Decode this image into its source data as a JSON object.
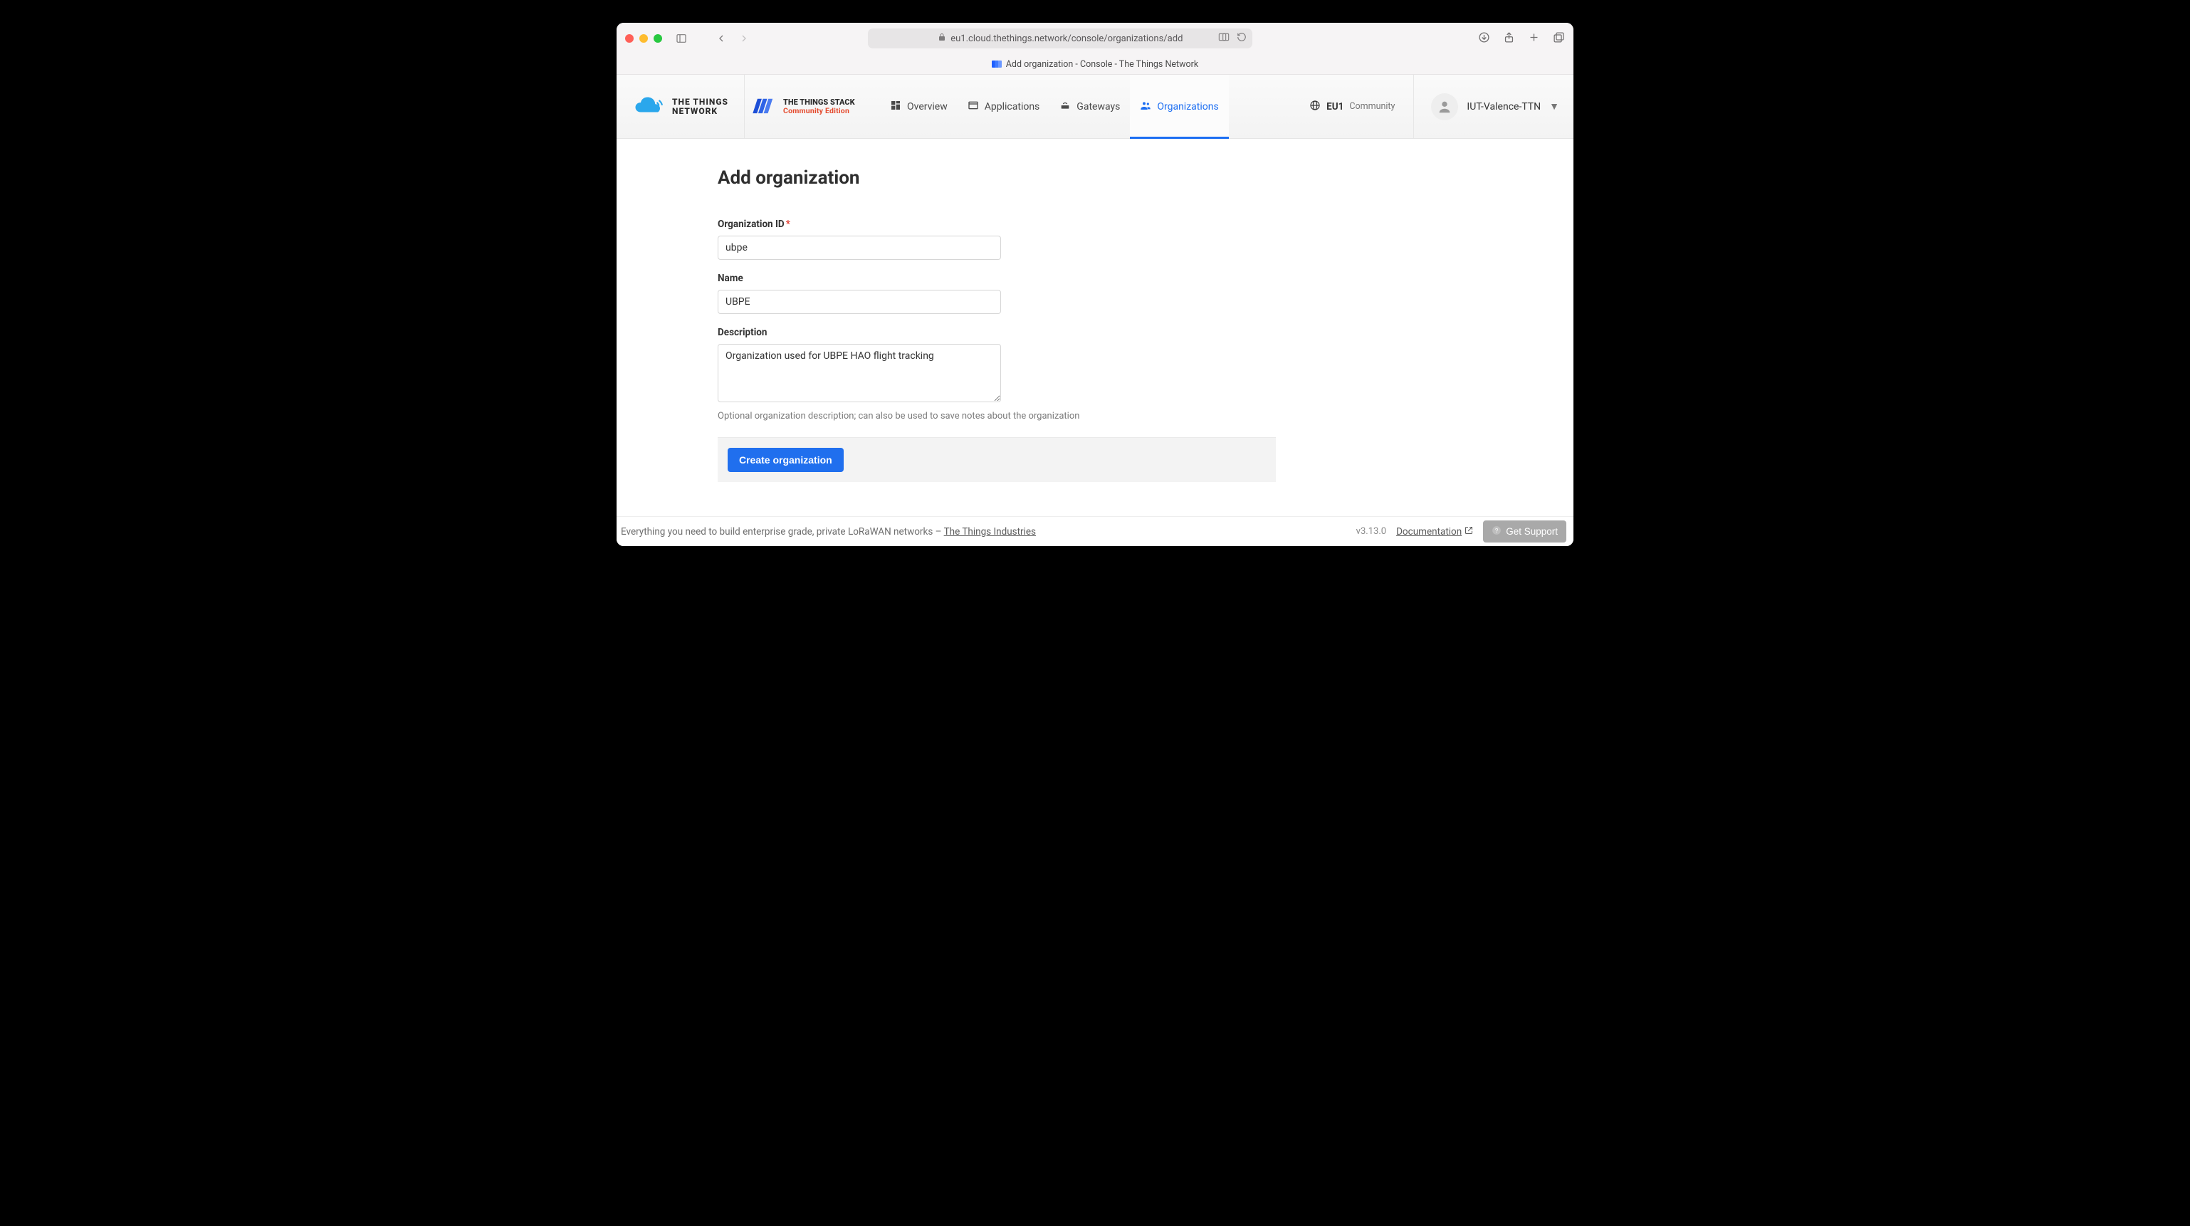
{
  "browser": {
    "url": "eu1.cloud.thethings.network/console/organizations/add",
    "tab_title": "Add organization - Console - The Things Network"
  },
  "header": {
    "brand_line1": "THE THINGS",
    "brand_line2": "NETWORK",
    "stack_line1": "THE THINGS STACK",
    "stack_line2": "Community Edition",
    "nav": {
      "overview": "Overview",
      "applications": "Applications",
      "gateways": "Gateways",
      "organizations": "Organizations"
    },
    "cluster_region": "EU1",
    "cluster_label": "Community",
    "user_name": "IUT-Valence-TTN"
  },
  "page": {
    "title": "Add organization",
    "fields": {
      "org_id": {
        "label": "Organization ID",
        "value": "ubpe"
      },
      "name": {
        "label": "Name",
        "value": "UBPE"
      },
      "desc": {
        "label": "Description",
        "value": "Organization used for UBPE HAO flight tracking",
        "help": "Optional organization description; can also be used to save notes about the organization"
      }
    },
    "submit_label": "Create organization"
  },
  "footer": {
    "tagline_prefix": "Everything you need to build enterprise grade, private LoRaWAN networks – ",
    "tagline_link": "The Things Industries",
    "version": "v3.13.0",
    "documentation": "Documentation",
    "support": "Get Support"
  }
}
